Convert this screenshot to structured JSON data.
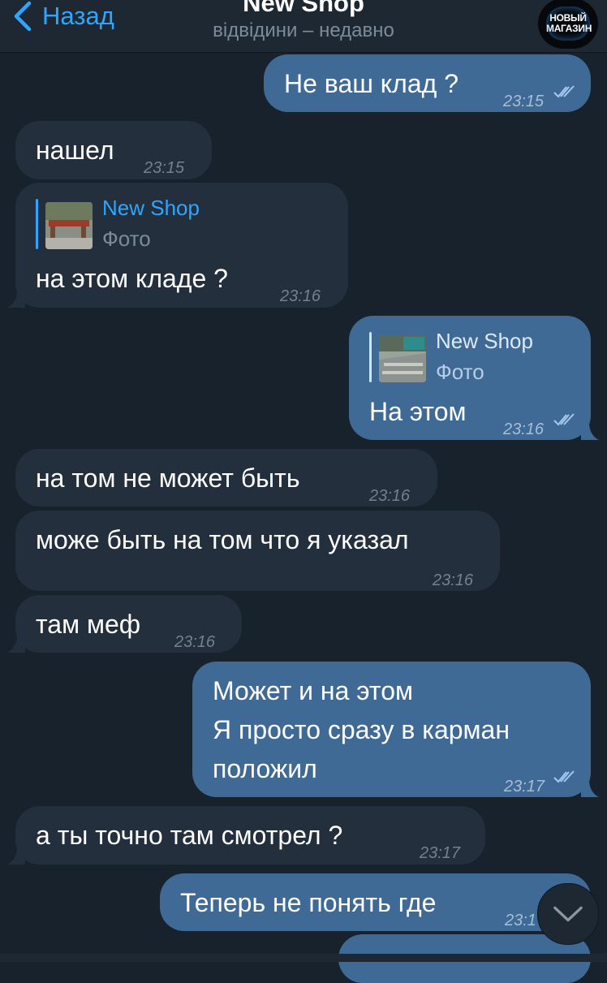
{
  "header": {
    "back_label": "Назад",
    "title": "New Shop",
    "subtitle": "відвідини – недавно",
    "avatar_text": "НОВЫЙ МАГАЗИН"
  },
  "colors": {
    "background": "#18222d",
    "incoming_bubble": "#232f3d",
    "outgoing_bubble": "#3f6a96",
    "accent": "#2ea6ff"
  },
  "messages": [
    {
      "dir": "out",
      "text": "Не ваш клад ?",
      "time": "23:15",
      "read": true
    },
    {
      "dir": "in",
      "text": "нашел",
      "time": "23:15"
    },
    {
      "dir": "in",
      "reply": {
        "name": "New Shop",
        "type": "Фото"
      },
      "text": "на этом кладе ?",
      "time": "23:16"
    },
    {
      "dir": "out",
      "reply": {
        "name": "New Shop",
        "type": "Фото"
      },
      "text": "На этом",
      "time": "23:16",
      "read": true
    },
    {
      "dir": "in",
      "text": "на том не может быть",
      "time": "23:16"
    },
    {
      "dir": "in",
      "text": "може быть на том что я указал",
      "time": "23:16"
    },
    {
      "dir": "in",
      "text": "там меф",
      "time": "23:16"
    },
    {
      "dir": "out",
      "lines": [
        "Может и на этом",
        "Я просто сразу в карман",
        "положил"
      ],
      "time": "23:17",
      "read": true
    },
    {
      "dir": "in",
      "text": "а ты точно там смотрел ?",
      "time": "23:17"
    },
    {
      "dir": "out",
      "text": "Теперь не понять где",
      "time": "23:1"
    }
  ],
  "scroll_button_icon": "chevron-down-icon"
}
